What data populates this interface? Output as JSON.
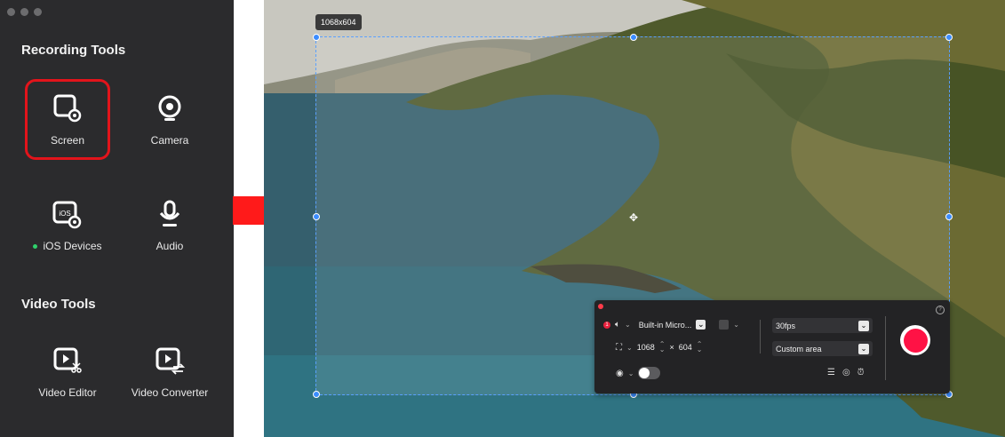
{
  "panel": {
    "recording_tools_title": "Recording Tools",
    "video_tools_title": "Video Tools",
    "tools": {
      "screen": "Screen",
      "camera": "Camera",
      "ios_devices": "iOS Devices",
      "audio": "Audio",
      "video_editor": "Video Editor",
      "video_converter": "Video Converter"
    },
    "ios_icon_text": "iOS"
  },
  "screen": {
    "dimension_tag": "1068x604"
  },
  "toolbar": {
    "mic_label": "Built-in Micro...",
    "width_value": "1068",
    "times_sign": "×",
    "height_value": "604",
    "fps_option": "30fps",
    "area_option": "Custom area",
    "badge_count": "1"
  },
  "colors": {
    "highlight": "#e3141b",
    "arrow": "#ff1a1a",
    "record": "#ff1245",
    "selection": "#3b8cff"
  }
}
